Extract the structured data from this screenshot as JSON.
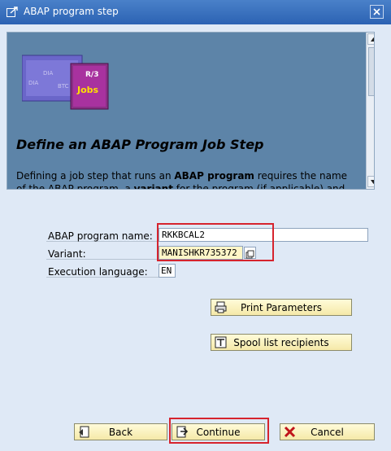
{
  "window": {
    "title": "ABAP program step"
  },
  "info": {
    "image_badge_top": "R/3",
    "image_badge_bottom": "Jobs",
    "heading": "Define an ABAP Program Job Step",
    "description_parts": [
      "Defining a job step that runs an ",
      "ABAP program",
      " requires the name of the ABAP program, a ",
      "variant",
      " for the program (if applicable) and the"
    ]
  },
  "form": {
    "program_label": "ABAP program name:",
    "program_value": "RKKBCAL2",
    "variant_label": "Variant:",
    "variant_value": "MANISHKR735372",
    "language_label": "Execution language:",
    "language_value": "EN"
  },
  "buttons": {
    "print_parameters": "Print Parameters",
    "spool_recipients": "Spool list recipients",
    "back": "Back",
    "continue": "Continue",
    "cancel": "Cancel"
  },
  "colors": {
    "titlebar": "#2b62b3",
    "panel": "#5d84a8",
    "highlight": "#d6242e",
    "button": "#f5e9a8"
  }
}
